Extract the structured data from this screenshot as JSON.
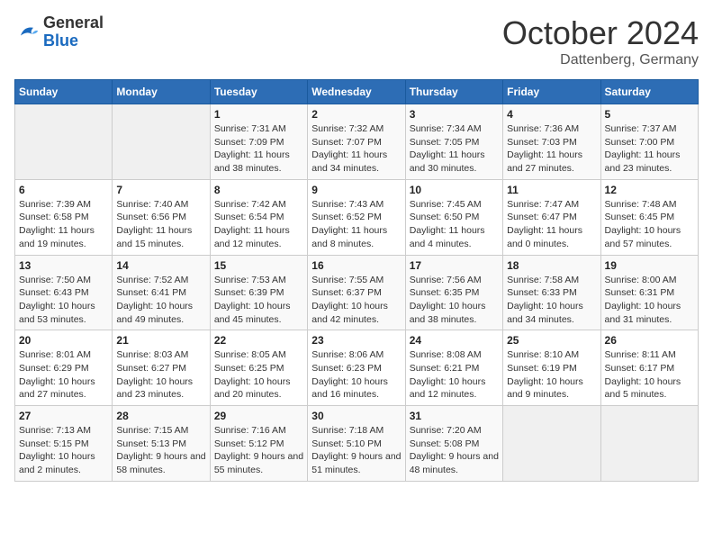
{
  "header": {
    "logo_general": "General",
    "logo_blue": "Blue",
    "month_title": "October 2024",
    "subtitle": "Dattenberg, Germany"
  },
  "weekdays": [
    "Sunday",
    "Monday",
    "Tuesday",
    "Wednesday",
    "Thursday",
    "Friday",
    "Saturday"
  ],
  "weeks": [
    [
      {
        "day": "",
        "sunrise": "",
        "sunset": "",
        "daylight": ""
      },
      {
        "day": "",
        "sunrise": "",
        "sunset": "",
        "daylight": ""
      },
      {
        "day": "1",
        "sunrise": "Sunrise: 7:31 AM",
        "sunset": "Sunset: 7:09 PM",
        "daylight": "Daylight: 11 hours and 38 minutes."
      },
      {
        "day": "2",
        "sunrise": "Sunrise: 7:32 AM",
        "sunset": "Sunset: 7:07 PM",
        "daylight": "Daylight: 11 hours and 34 minutes."
      },
      {
        "day": "3",
        "sunrise": "Sunrise: 7:34 AM",
        "sunset": "Sunset: 7:05 PM",
        "daylight": "Daylight: 11 hours and 30 minutes."
      },
      {
        "day": "4",
        "sunrise": "Sunrise: 7:36 AM",
        "sunset": "Sunset: 7:03 PM",
        "daylight": "Daylight: 11 hours and 27 minutes."
      },
      {
        "day": "5",
        "sunrise": "Sunrise: 7:37 AM",
        "sunset": "Sunset: 7:00 PM",
        "daylight": "Daylight: 11 hours and 23 minutes."
      }
    ],
    [
      {
        "day": "6",
        "sunrise": "Sunrise: 7:39 AM",
        "sunset": "Sunset: 6:58 PM",
        "daylight": "Daylight: 11 hours and 19 minutes."
      },
      {
        "day": "7",
        "sunrise": "Sunrise: 7:40 AM",
        "sunset": "Sunset: 6:56 PM",
        "daylight": "Daylight: 11 hours and 15 minutes."
      },
      {
        "day": "8",
        "sunrise": "Sunrise: 7:42 AM",
        "sunset": "Sunset: 6:54 PM",
        "daylight": "Daylight: 11 hours and 12 minutes."
      },
      {
        "day": "9",
        "sunrise": "Sunrise: 7:43 AM",
        "sunset": "Sunset: 6:52 PM",
        "daylight": "Daylight: 11 hours and 8 minutes."
      },
      {
        "day": "10",
        "sunrise": "Sunrise: 7:45 AM",
        "sunset": "Sunset: 6:50 PM",
        "daylight": "Daylight: 11 hours and 4 minutes."
      },
      {
        "day": "11",
        "sunrise": "Sunrise: 7:47 AM",
        "sunset": "Sunset: 6:47 PM",
        "daylight": "Daylight: 11 hours and 0 minutes."
      },
      {
        "day": "12",
        "sunrise": "Sunrise: 7:48 AM",
        "sunset": "Sunset: 6:45 PM",
        "daylight": "Daylight: 10 hours and 57 minutes."
      }
    ],
    [
      {
        "day": "13",
        "sunrise": "Sunrise: 7:50 AM",
        "sunset": "Sunset: 6:43 PM",
        "daylight": "Daylight: 10 hours and 53 minutes."
      },
      {
        "day": "14",
        "sunrise": "Sunrise: 7:52 AM",
        "sunset": "Sunset: 6:41 PM",
        "daylight": "Daylight: 10 hours and 49 minutes."
      },
      {
        "day": "15",
        "sunrise": "Sunrise: 7:53 AM",
        "sunset": "Sunset: 6:39 PM",
        "daylight": "Daylight: 10 hours and 45 minutes."
      },
      {
        "day": "16",
        "sunrise": "Sunrise: 7:55 AM",
        "sunset": "Sunset: 6:37 PM",
        "daylight": "Daylight: 10 hours and 42 minutes."
      },
      {
        "day": "17",
        "sunrise": "Sunrise: 7:56 AM",
        "sunset": "Sunset: 6:35 PM",
        "daylight": "Daylight: 10 hours and 38 minutes."
      },
      {
        "day": "18",
        "sunrise": "Sunrise: 7:58 AM",
        "sunset": "Sunset: 6:33 PM",
        "daylight": "Daylight: 10 hours and 34 minutes."
      },
      {
        "day": "19",
        "sunrise": "Sunrise: 8:00 AM",
        "sunset": "Sunset: 6:31 PM",
        "daylight": "Daylight: 10 hours and 31 minutes."
      }
    ],
    [
      {
        "day": "20",
        "sunrise": "Sunrise: 8:01 AM",
        "sunset": "Sunset: 6:29 PM",
        "daylight": "Daylight: 10 hours and 27 minutes."
      },
      {
        "day": "21",
        "sunrise": "Sunrise: 8:03 AM",
        "sunset": "Sunset: 6:27 PM",
        "daylight": "Daylight: 10 hours and 23 minutes."
      },
      {
        "day": "22",
        "sunrise": "Sunrise: 8:05 AM",
        "sunset": "Sunset: 6:25 PM",
        "daylight": "Daylight: 10 hours and 20 minutes."
      },
      {
        "day": "23",
        "sunrise": "Sunrise: 8:06 AM",
        "sunset": "Sunset: 6:23 PM",
        "daylight": "Daylight: 10 hours and 16 minutes."
      },
      {
        "day": "24",
        "sunrise": "Sunrise: 8:08 AM",
        "sunset": "Sunset: 6:21 PM",
        "daylight": "Daylight: 10 hours and 12 minutes."
      },
      {
        "day": "25",
        "sunrise": "Sunrise: 8:10 AM",
        "sunset": "Sunset: 6:19 PM",
        "daylight": "Daylight: 10 hours and 9 minutes."
      },
      {
        "day": "26",
        "sunrise": "Sunrise: 8:11 AM",
        "sunset": "Sunset: 6:17 PM",
        "daylight": "Daylight: 10 hours and 5 minutes."
      }
    ],
    [
      {
        "day": "27",
        "sunrise": "Sunrise: 7:13 AM",
        "sunset": "Sunset: 5:15 PM",
        "daylight": "Daylight: 10 hours and 2 minutes."
      },
      {
        "day": "28",
        "sunrise": "Sunrise: 7:15 AM",
        "sunset": "Sunset: 5:13 PM",
        "daylight": "Daylight: 9 hours and 58 minutes."
      },
      {
        "day": "29",
        "sunrise": "Sunrise: 7:16 AM",
        "sunset": "Sunset: 5:12 PM",
        "daylight": "Daylight: 9 hours and 55 minutes."
      },
      {
        "day": "30",
        "sunrise": "Sunrise: 7:18 AM",
        "sunset": "Sunset: 5:10 PM",
        "daylight": "Daylight: 9 hours and 51 minutes."
      },
      {
        "day": "31",
        "sunrise": "Sunrise: 7:20 AM",
        "sunset": "Sunset: 5:08 PM",
        "daylight": "Daylight: 9 hours and 48 minutes."
      },
      {
        "day": "",
        "sunrise": "",
        "sunset": "",
        "daylight": ""
      },
      {
        "day": "",
        "sunrise": "",
        "sunset": "",
        "daylight": ""
      }
    ]
  ]
}
